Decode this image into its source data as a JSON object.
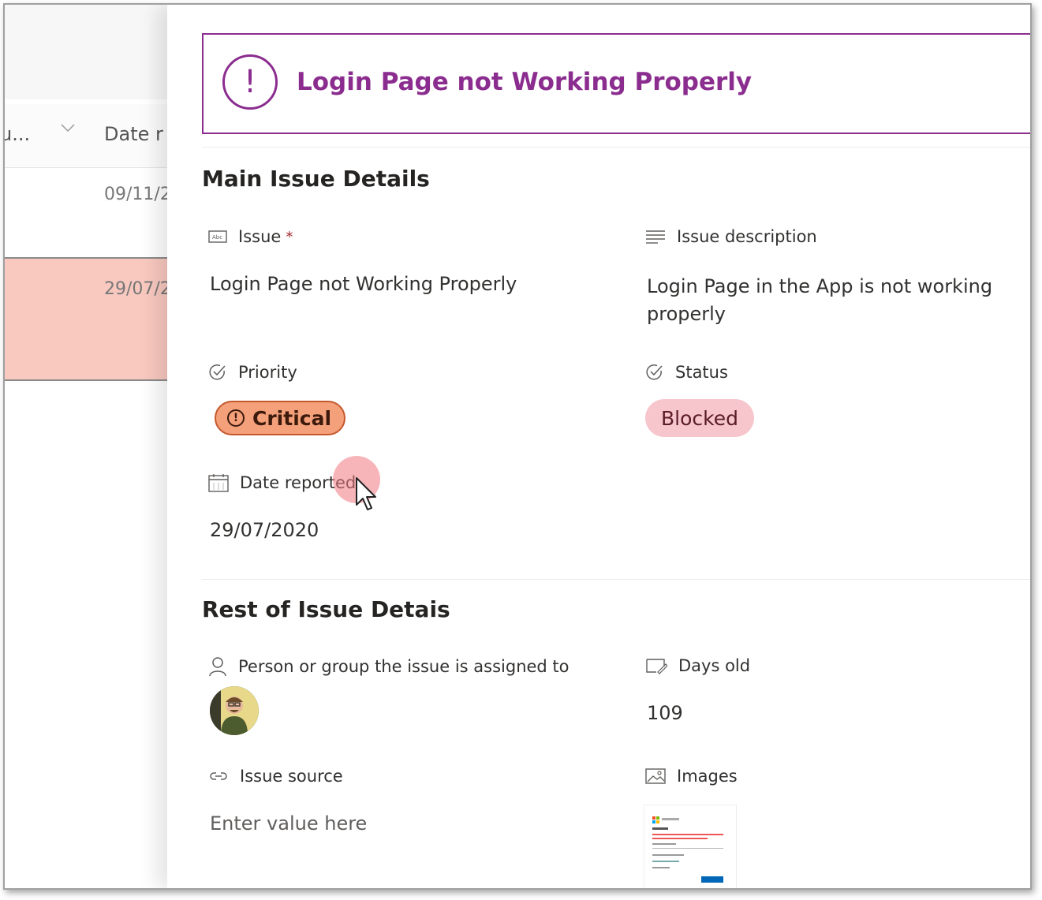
{
  "list": {
    "col_truncated": "u...",
    "col_date": "Date r",
    "row1_date": "09/11/2",
    "row2_date": "29/07/2"
  },
  "banner": {
    "title": "Login Page not Working Properly"
  },
  "main_section": {
    "title": "Main Issue Details",
    "issue_label": "Issue",
    "issue_required": "*",
    "issue_value": "Login Page not Working Properly",
    "description_label": "Issue description",
    "description_value": "Login Page in the App is not working properly",
    "priority_label": "Priority",
    "priority_value": "Critical",
    "status_label": "Status",
    "status_value": "Blocked",
    "date_label": "Date reported",
    "date_value": "29/07/2020"
  },
  "rest_section": {
    "title": "Rest of Issue Detais",
    "assigned_label": "Person or group the issue is assigned to",
    "days_label": "Days old",
    "days_value": "109",
    "source_label": "Issue source",
    "source_placeholder": "Enter value here",
    "images_label": "Images"
  },
  "colors": {
    "accent": "#8b2d8f",
    "critical_bg": "#f4a07a",
    "blocked_bg": "#f7c6cd",
    "selected_row": "#f9c9c0"
  },
  "icons": {
    "banner": "alert-circle-icon",
    "issue": "text-field-icon",
    "description": "multiline-text-icon",
    "priority": "choice-check-icon",
    "status": "choice-check-icon",
    "date": "calendar-icon",
    "assigned": "person-icon",
    "days": "calculated-icon",
    "source": "link-icon",
    "images": "image-icon"
  }
}
